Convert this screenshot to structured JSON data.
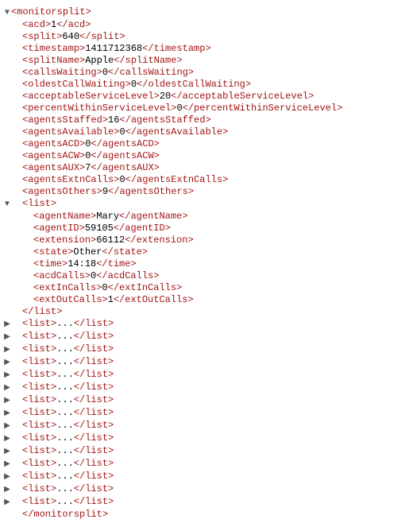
{
  "root": {
    "tag": "monitorsplit",
    "acd": "1",
    "split": "640",
    "timestamp": "1411712368",
    "splitName": "Apple",
    "callsWaiting": "0",
    "oldestCallWaiting": "0",
    "acceptableServiceLevel": "20",
    "percentWithinServiceLevel": "0",
    "agentsStaffed": "16",
    "agentsAvailable": "0",
    "agentsACD": "0",
    "agentsACW": "0",
    "agentsAUX": "7",
    "agentsExtnCalls": "0",
    "agentsOthers": "9"
  },
  "listOpen": {
    "tag": "list",
    "agentName": "Mary",
    "agentID": "59105",
    "extension": "66112",
    "state": "Other",
    "time": "14:18",
    "acdCalls": "0",
    "extInCalls": "0",
    "extOutCalls": "1"
  },
  "collapsedLists": [
    {
      "tag": "list"
    },
    {
      "tag": "list"
    },
    {
      "tag": "list"
    },
    {
      "tag": "list"
    },
    {
      "tag": "list"
    },
    {
      "tag": "list"
    },
    {
      "tag": "list"
    },
    {
      "tag": "list"
    },
    {
      "tag": "list"
    },
    {
      "tag": "list"
    },
    {
      "tag": "list"
    },
    {
      "tag": "list"
    },
    {
      "tag": "list"
    },
    {
      "tag": "list"
    },
    {
      "tag": "list"
    }
  ],
  "ellipsis": "..."
}
